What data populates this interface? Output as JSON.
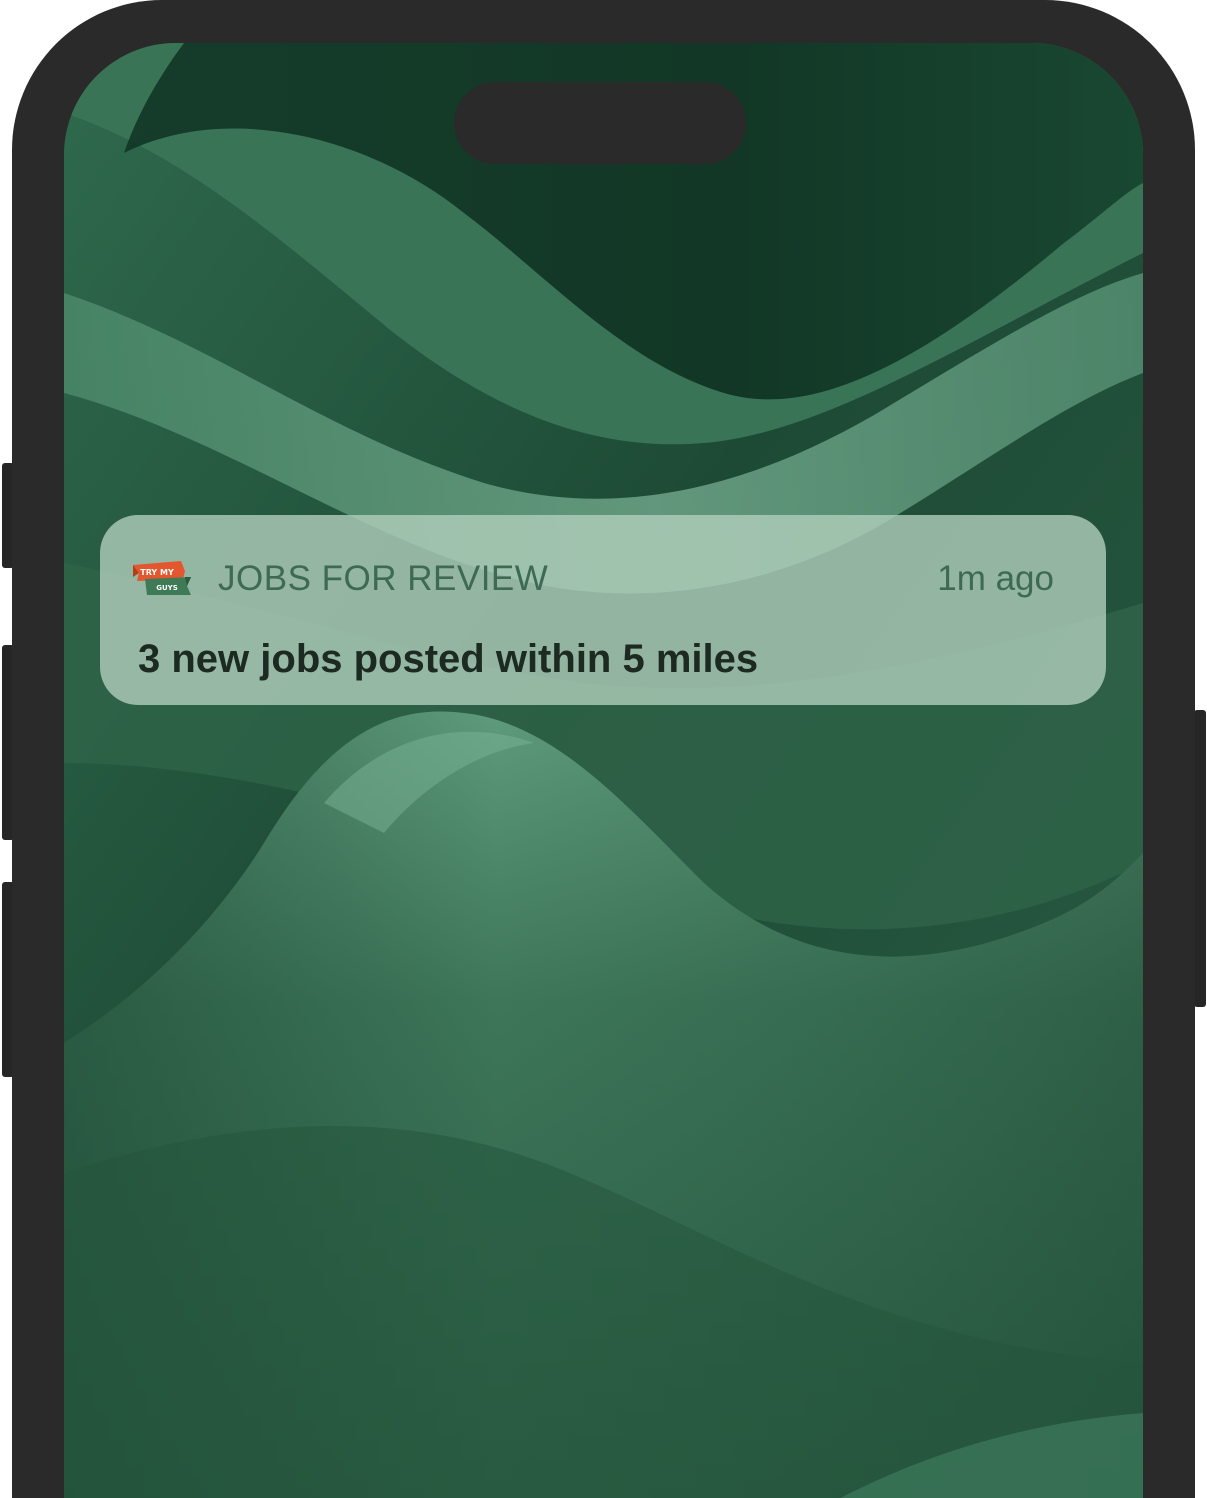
{
  "notification": {
    "app_name": "JOBS FOR REVIEW",
    "time": "1m ago",
    "message": "3 new jobs posted within 5 miles",
    "app_icon": {
      "name": "try-my-guys-logo",
      "text_top": "TRY MY",
      "text_bottom": "GUYS",
      "colors": {
        "top_banner": "#e4572e",
        "bottom_banner": "#3f7a56"
      }
    }
  },
  "theme": {
    "frame_color": "#2a2a2a",
    "wallpaper_base": "#1e4a35",
    "notification_bg": "#b0cebc",
    "notification_title_color": "#3e6a55",
    "notification_body_color": "#1c2a22"
  }
}
